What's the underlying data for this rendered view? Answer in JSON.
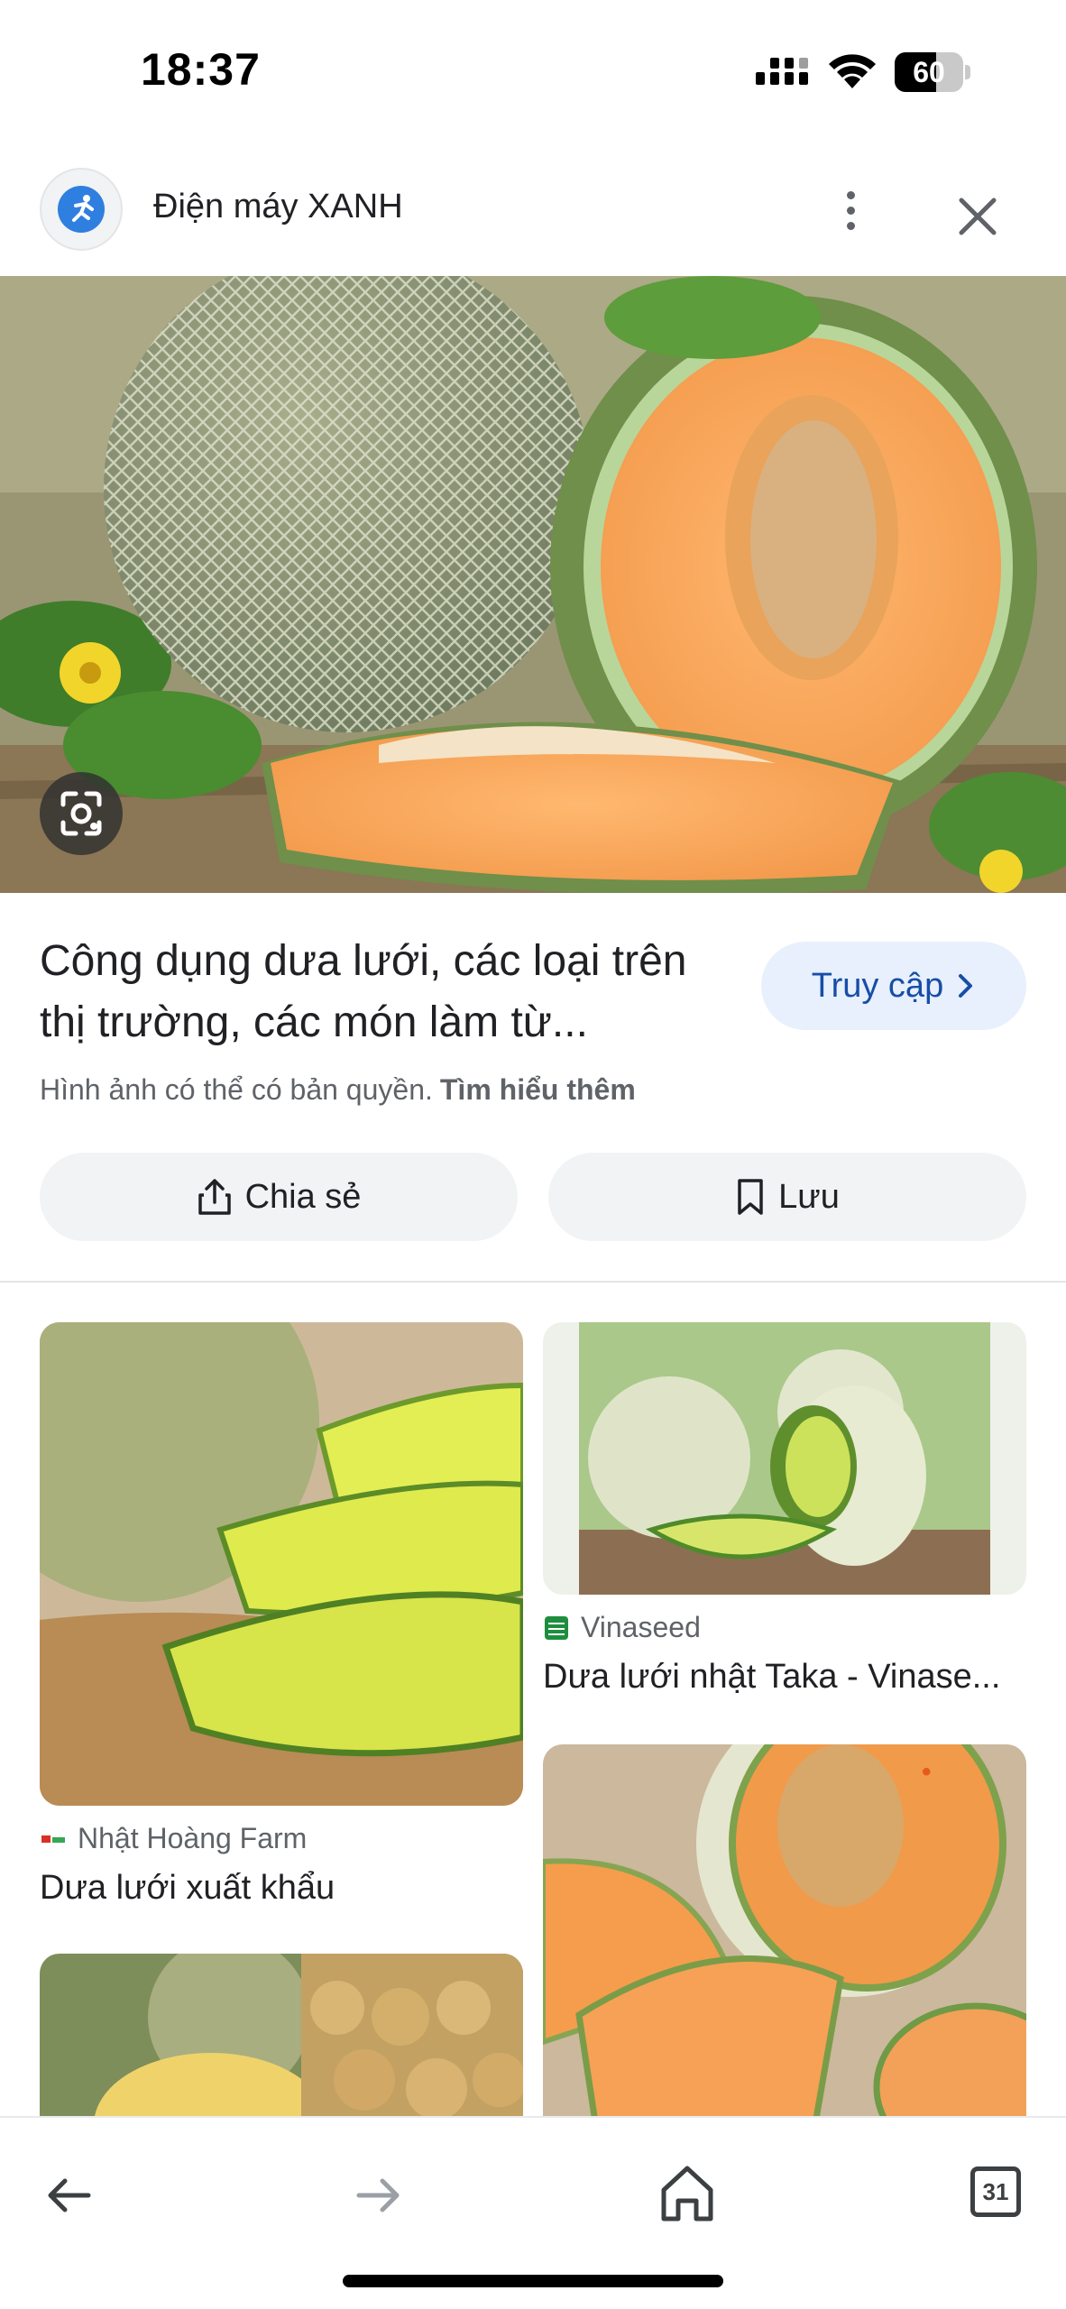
{
  "status_bar": {
    "time": "18:37",
    "battery_level": "60",
    "battery_fraction": 0.6
  },
  "header": {
    "site_name": "Điện máy XANH",
    "logo_icon": "site-favicon-icon",
    "more_icon": "more-vert-icon",
    "close_icon": "close-icon"
  },
  "hero": {
    "image": "cantaloupe-melons-photo",
    "lens_icon": "lens-search-icon"
  },
  "result": {
    "title": "Công dụng dưa lưới, các loại trên thị trường, các món làm từ...",
    "visit_label": "Truy cập",
    "copyright_text": "Hình ảnh có thể có bản quyền.",
    "learn_more": "Tìm hiểu thêm"
  },
  "actions": {
    "share_label": "Chia sẻ",
    "save_label": "Lưu"
  },
  "related": {
    "items": [
      {
        "source": "Nhật Hoàng Farm",
        "caption": "Dưa lưới xuất khẩu"
      },
      {
        "source": "Vinaseed",
        "caption": "Dưa lưới nhật Taka - Vinase..."
      },
      {
        "source": "",
        "caption": ""
      },
      {
        "source": "",
        "caption": ""
      }
    ]
  },
  "bottom_nav": {
    "back_icon": "arrow-back-icon",
    "forward_icon": "arrow-forward-icon",
    "home_icon": "home-icon",
    "tabs_count": "31"
  },
  "colors": {
    "accent": "#174ea6",
    "visit_bg": "#e8f0fe",
    "chip_bg": "#f1f3f4"
  }
}
